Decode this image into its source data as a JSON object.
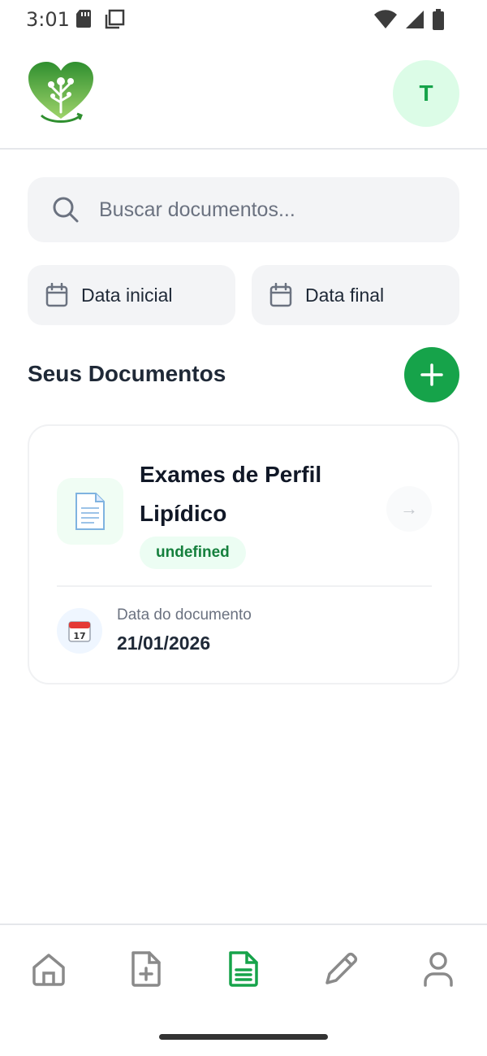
{
  "status_bar": {
    "time": "3:01"
  },
  "header": {
    "avatar_initial": "T"
  },
  "search": {
    "placeholder": "Buscar documentos..."
  },
  "filters": {
    "start_label": "Data inicial",
    "end_label": "Data final"
  },
  "section": {
    "title": "Seus Documentos"
  },
  "documents": [
    {
      "title": "Exames de Perfil Lipídico",
      "badge": "undefined",
      "date_label": "Data do documento",
      "date_value": "21/01/2026"
    }
  ],
  "colors": {
    "primary": "#16a34a",
    "primary_light": "#dcfce7",
    "inactive": "#8a8a8a"
  },
  "nav": {
    "items": [
      {
        "icon": "home-icon"
      },
      {
        "icon": "add-document-icon"
      },
      {
        "icon": "documents-icon",
        "active": true
      },
      {
        "icon": "edit-icon"
      },
      {
        "icon": "profile-icon"
      }
    ]
  }
}
